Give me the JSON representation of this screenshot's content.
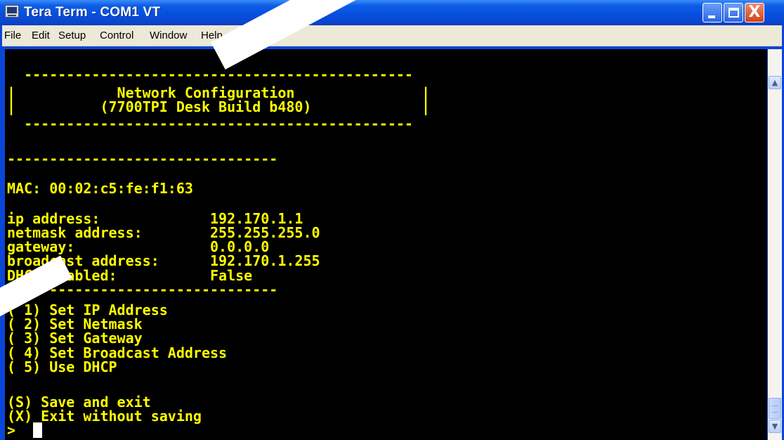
{
  "window": {
    "title": "Tera Term - COM1 VT",
    "icon": "teraterm-app-icon",
    "controls": {
      "minimize_icon": "minimize-icon",
      "maximize_icon": "maximize-icon",
      "close_icon": "close-icon",
      "close_glyph": "X"
    }
  },
  "menu": [
    "File",
    "Edit",
    "Setup",
    "Control",
    "Window",
    "Help"
  ],
  "terminal": {
    "colors": {
      "foreground": "#ffff00",
      "background": "#000000",
      "cursor": "#ffffff"
    },
    "header_rule_top": "  ----------------------------------------------",
    "header_line1": "|            Network Configuration               |",
    "header_line2": "|          (7700TPI Desk Build b480)             |",
    "header_rule_bottom": "  ----------------------------------------------",
    "separator1": "--------------------------------",
    "mac_line": "MAC: 00:02:c5:fe:f1:63",
    "fields": [
      {
        "label": "ip address:",
        "value": "192.170.1.1"
      },
      {
        "label": "netmask address:",
        "value": "255.255.255.0"
      },
      {
        "label": "gateway:",
        "value": "0.0.0.0"
      },
      {
        "label": "broadcast address:",
        "value": "192.170.1.255"
      },
      {
        "label": "DHCP enabled:",
        "value": "False"
      }
    ],
    "separator2": "--------------------------------",
    "options": [
      "( 1) Set IP Address",
      "( 2) Set Netmask",
      "( 3) Set Gateway",
      "( 4) Set Broadcast Address",
      "( 5) Use DHCP"
    ],
    "save_option": "(S) Save and exit",
    "exit_option": "(X) Exit without saving",
    "prompt": ">"
  },
  "scrollbar": {
    "up_icon": "scroll-up-icon",
    "down_icon": "scroll-down-icon",
    "up_glyph": "▲",
    "down_glyph": "▼"
  }
}
